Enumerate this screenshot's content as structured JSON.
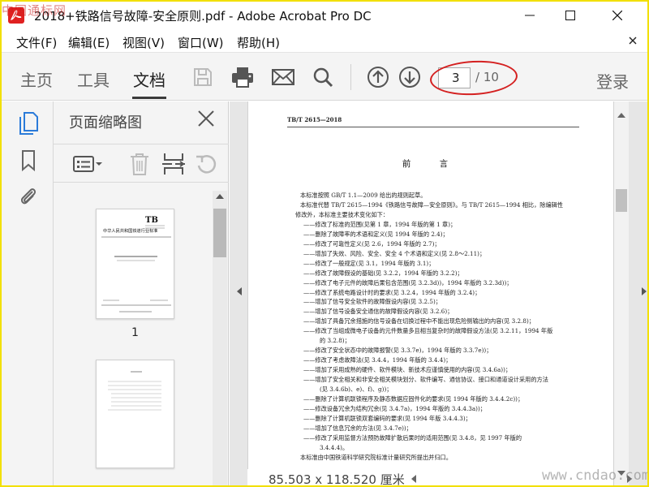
{
  "window": {
    "title": "2018+铁路信号故障-安全原则.pdf - Adobe Acrobat Pro DC"
  },
  "watermark": {
    "top": "中国通标网",
    "bottom": "www.cndao.com"
  },
  "menu": {
    "file": "文件(F)",
    "edit": "编辑(E)",
    "view": "视图(V)",
    "window": "窗口(W)",
    "help": "帮助(H)"
  },
  "toolbar": {
    "tabs": [
      "主页",
      "工具",
      "文档"
    ],
    "active_tab": "文档",
    "current_page": "3",
    "total_pages": "/ 10",
    "login": "登录"
  },
  "thumbnails": {
    "title": "页面缩略图",
    "pages": [
      {
        "label": "1",
        "org": "中华人民共和国铁道行业标准",
        "badge": "TB"
      },
      {
        "label": "2"
      }
    ]
  },
  "document": {
    "header": "TB/T 2615—2018",
    "title": "前 言",
    "lines": [
      "本标准按照 GB/T 1.1—2009 给出的规则起草。",
      "本标准代替 TB/T 2615—1994《铁路信号故障—安全原则》。与 TB/T 2615—1994 相比，除编辑性",
      "修改外，本标准主要技术变化如下：",
      "——修改了标准的范围(见第 1 章，1994 年版的第 1 章)；",
      "——删除了故障率的术语和定义(见 1994 年版的 2.4)；",
      "——修改了可靠性定义(见 2.6，1994 年版的 2.7)；",
      "——增加了失效、风险、安全、安全 4 个术语和定义(见 2.8～2.11)；",
      "——修改了一般规定(见 3.1，1994 年版的 3.1)；",
      "——修改了故障假设的基础(见 3.2.2，1994 年版的 3.2.2)；",
      "——修改了电子元件的故障后果包含范围(见 3.2.3d))，1994 年版的 3.2.3d))；",
      "——修改了系统电路设计时的要求(见 3.2.4，1994 年版的 3.2.4)；",
      "——增加了信号安全软件的故障假设内容(见 3.2.5)；",
      "——增加了信号设备安全通信的故障假设内容(见 3.2.6)；",
      "——增加了具备冗余措施的信号设备在切换过程中不能出现危险侧输出的内容(见 3.2.8)；",
      "——修改了当组成微电子设备的元件数量多且相当复杂时的故障假设方法(见 3.2.11，1994 年版",
      "的 3.2.8)；",
      "——修改了安全状态中的故障报警(见 3.3.7e)，1994 年版的 3.3.7e))；",
      "——修改了考虑故障法(见 3.4.4，1994 年版的 3.4.4)；",
      "——增加了采用成熟的硬件、软件模块、新技术应谨慎使用的内容(见 3.4.6a))；",
      "——增加了安全相关和非安全相关模块划分、软件编写、通信协议、接口和通道设计采用的方法",
      "(见 3.4.6b)、e)、f)、g))；",
      "——删除了计算机联锁程序及静态数据应固件化的要求(见 1994 年版的 3.4.4.2c))；",
      "——修改设备冗余为结构冗余(见 3.4.7a)，1994 年版的 3.4.4.3a))；",
      "——删除了计算机联锁双套编码的要求(见 1994 年版 3.4.4.3)；",
      "——增加了信息冗余的方法(见 3.4.7e))；",
      "——修改了采用监督方法预防故障扩散后果时的适用范围(见 3.4.8，见 1997 年版的",
      "3.4.4.4)。",
      "本标准由中国铁道科学研究院标准计量研究所提出并归口。"
    ]
  },
  "status": {
    "dimensions": "85.503 x 118.520 厘米"
  }
}
